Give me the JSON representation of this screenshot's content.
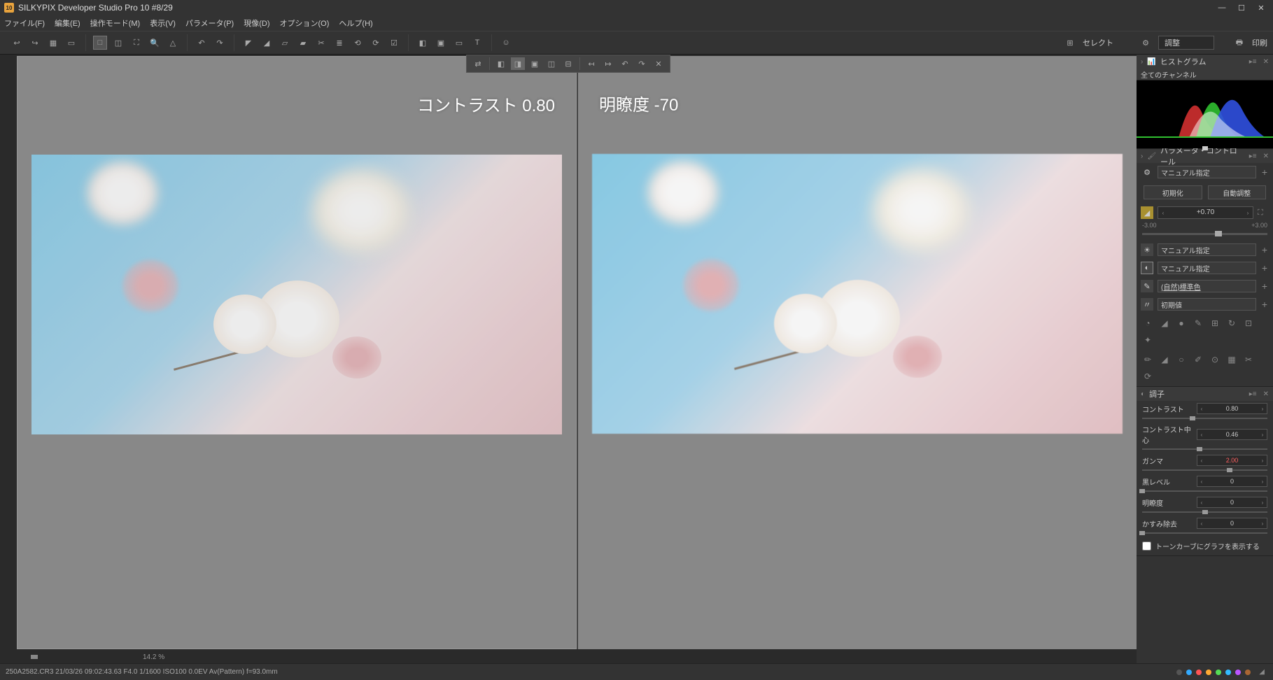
{
  "title": "SILKYPIX Developer Studio Pro 10   #8/29",
  "app_badge": "10",
  "menubar": [
    "ファイル(F)",
    "編集(E)",
    "操作モード(M)",
    "表示(V)",
    "パラメータ(P)",
    "現像(D)",
    "オプション(O)",
    "ヘルプ(H)"
  ],
  "toolbar_right": {
    "select_label": "セレクト",
    "adjust_label": "調整",
    "print_label": "印刷"
  },
  "pane_labels": {
    "left": "コントラスト 0.80",
    "right": "明瞭度 -70"
  },
  "zoom": "14.2  %",
  "histogram": {
    "title": "ヒストグラム",
    "channel": "全てのチャンネル"
  },
  "param_control": {
    "title": "パラメータ・コントロール",
    "mode": "マニュアル指定",
    "btn_init": "初期化",
    "btn_auto": "自動調整",
    "exposure_value": "+0.70",
    "range_min": "-3.00",
    "range_max": "+3.00",
    "exposure_thumb_pct": 61,
    "rows": [
      {
        "icon": "☀",
        "value": "マニュアル指定",
        "cls": ""
      },
      {
        "icon": "◐",
        "value": "マニュアル指定",
        "cls": "highlight"
      },
      {
        "icon": "✎",
        "value": "(自然)標準色",
        "cls": "",
        "underline": true
      },
      {
        "icon": "〃",
        "value": "初期値",
        "cls": ""
      }
    ]
  },
  "tone": {
    "title": "調子",
    "params": [
      {
        "label": "コントラスト",
        "value": "0.80",
        "thumb": 40,
        "red": false
      },
      {
        "label": "コントラスト中心",
        "value": "0.46",
        "thumb": 46,
        "red": false
      },
      {
        "label": "ガンマ",
        "value": "2.00",
        "thumb": 70,
        "red": true
      },
      {
        "label": "黒レベル",
        "value": "0",
        "thumb": 0,
        "red": false
      },
      {
        "label": "明瞭度",
        "value": "0",
        "thumb": 50,
        "red": false
      },
      {
        "label": "かすみ除去",
        "value": "0",
        "thumb": 0,
        "red": false
      }
    ],
    "checkbox": "トーンカーブにグラフを表示する"
  },
  "status": "250A2582.CR3  21/03/26 09:02:43.63  F4.0  1/1600  ISO100   0.0EV  Av(Pattern)  f=93.0mm",
  "color_dots": [
    "#555",
    "#3af",
    "#f55",
    "#fa3",
    "#5d5",
    "#3bf",
    "#b5f",
    "#a63"
  ]
}
